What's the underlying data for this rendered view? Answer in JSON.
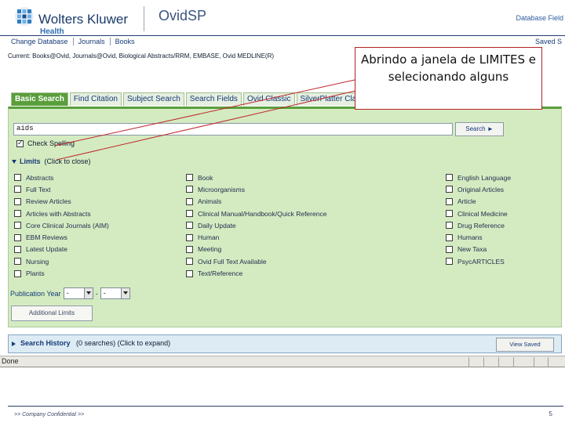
{
  "header": {
    "brand": "Wolters Kluwer",
    "brand_sub": "Health",
    "product": "OvidSP",
    "database_fields": "Database Field"
  },
  "topnav": {
    "items": [
      "Change Database",
      "Journals",
      "Books"
    ],
    "saved": "Saved S"
  },
  "current": "Current: Books@Ovid, Journals@Ovid, Biological Abstracts/RRM, EMBASE, Ovid MEDLINE(R)",
  "tabs": [
    {
      "label": "Basic Search",
      "active": true
    },
    {
      "label": "Find Citation",
      "active": false
    },
    {
      "label": "Subject Search",
      "active": false
    },
    {
      "label": "Search Fields",
      "active": false
    },
    {
      "label": "Ovid Classic",
      "active": false
    },
    {
      "label": "SilverPlatter Classic",
      "active": false
    }
  ],
  "search": {
    "value": "aids",
    "button": "Search ►",
    "spell_label": "Check Spelling",
    "spell_checked": true
  },
  "limits": {
    "title": "Limits",
    "hint": "(Click to close)",
    "col1": [
      "Abstracts",
      "Full Text",
      "Review Articles",
      "Articles with Abstracts",
      "Core Clinical Journals (AIM)",
      "EBM Reviews",
      "Latest Update",
      "Nursing",
      "Plants"
    ],
    "col2": [
      "Book",
      "Microorganisms",
      "Animals",
      "Clinical Manual/Handbook/Quick Reference",
      "Daily Update",
      "Human",
      "Meeting",
      "Ovid Full Text Available",
      "Text/Reference"
    ],
    "col3": [
      "English Language",
      "Original Articles",
      "Article",
      "Clinical Medicine",
      "Drug Reference",
      "Humans",
      "New Taxa",
      "PsycARTICLES"
    ],
    "pub_year_label": "Publication Year",
    "pub_year_from": "-",
    "pub_year_to": "-",
    "additional": "Additional Limits"
  },
  "history": {
    "title": "Search History",
    "detail": "(0 searches) (Click to expand)",
    "view_saved": "View Saved"
  },
  "status": "Done",
  "footer": {
    "left": ">> Company Confidential >>",
    "page": "5"
  },
  "annotation": {
    "text": "Abrindo a janela de LIMITES e selecionando alguns",
    "line_color": "#c0282d"
  },
  "colors": {
    "panel_green": "#d4ebc1",
    "tab_active": "#5a9e3c",
    "navy": "#1f3b6e"
  }
}
